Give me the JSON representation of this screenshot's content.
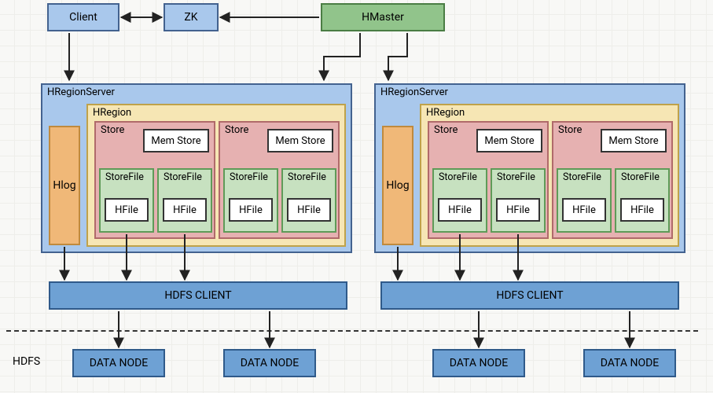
{
  "top": {
    "client": "Client",
    "zk": "ZK",
    "hmaster": "HMaster"
  },
  "regionServers": [
    {
      "title": "HRegionServer",
      "hlog": "Hlog",
      "hregion": {
        "title": "HRegion",
        "stores": [
          {
            "title": "Store",
            "memStore": "Mem Store",
            "storeFiles": [
              {
                "title": "StoreFile",
                "hfile": "HFile"
              },
              {
                "title": "StoreFile",
                "hfile": "HFile"
              }
            ]
          },
          {
            "title": "Store",
            "memStore": "Mem Store",
            "storeFiles": [
              {
                "title": "StoreFile",
                "hfile": "HFile"
              },
              {
                "title": "StoreFile",
                "hfile": "HFile"
              }
            ]
          }
        ]
      },
      "hdfsClient": "HDFS CLIENT",
      "dataNodes": [
        "DATA NODE",
        "DATA NODE"
      ]
    },
    {
      "title": "HRegionServer",
      "hlog": "Hlog",
      "hregion": {
        "title": "HRegion",
        "stores": [
          {
            "title": "Store",
            "memStore": "Mem Store",
            "storeFiles": [
              {
                "title": "StoreFile",
                "hfile": "HFile"
              },
              {
                "title": "StoreFile",
                "hfile": "HFile"
              }
            ]
          },
          {
            "title": "Store",
            "memStore": "Mem Store",
            "storeFiles": [
              {
                "title": "StoreFile",
                "hfile": "HFile"
              },
              {
                "title": "StoreFile",
                "hfile": "HFile"
              }
            ]
          }
        ]
      },
      "hdfsClient": "HDFS CLIENT",
      "dataNodes": [
        "DATA NODE",
        "DATA NODE"
      ]
    }
  ],
  "hdfsLabel": "HDFS",
  "colors": {
    "blue": "#a9c8ec",
    "green": "#91c48b",
    "yellow": "#f6e6b4",
    "red": "#e6b1b1",
    "orange": "#f0b878",
    "lightGreen": "#c7e1c0",
    "darkBlue": "#6ea1d4"
  }
}
